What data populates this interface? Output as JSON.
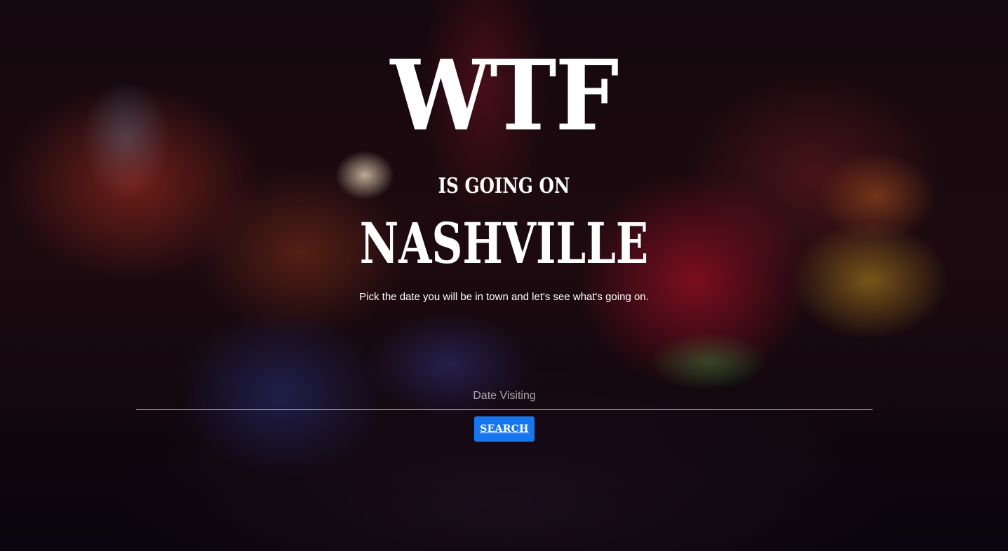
{
  "hero": {
    "title_main": "WTF",
    "title_middle": "IS GOING ON",
    "title_city": "NASHVILLE",
    "subtitle": "Pick the date you will be in town and let's see what's going on."
  },
  "search_form": {
    "date_placeholder": "Date Visiting",
    "date_value": "",
    "search_label": "SEARCH"
  },
  "colors": {
    "button_background": "#1777f1",
    "text": "#ffffff",
    "underline": "#bfbfbf"
  }
}
